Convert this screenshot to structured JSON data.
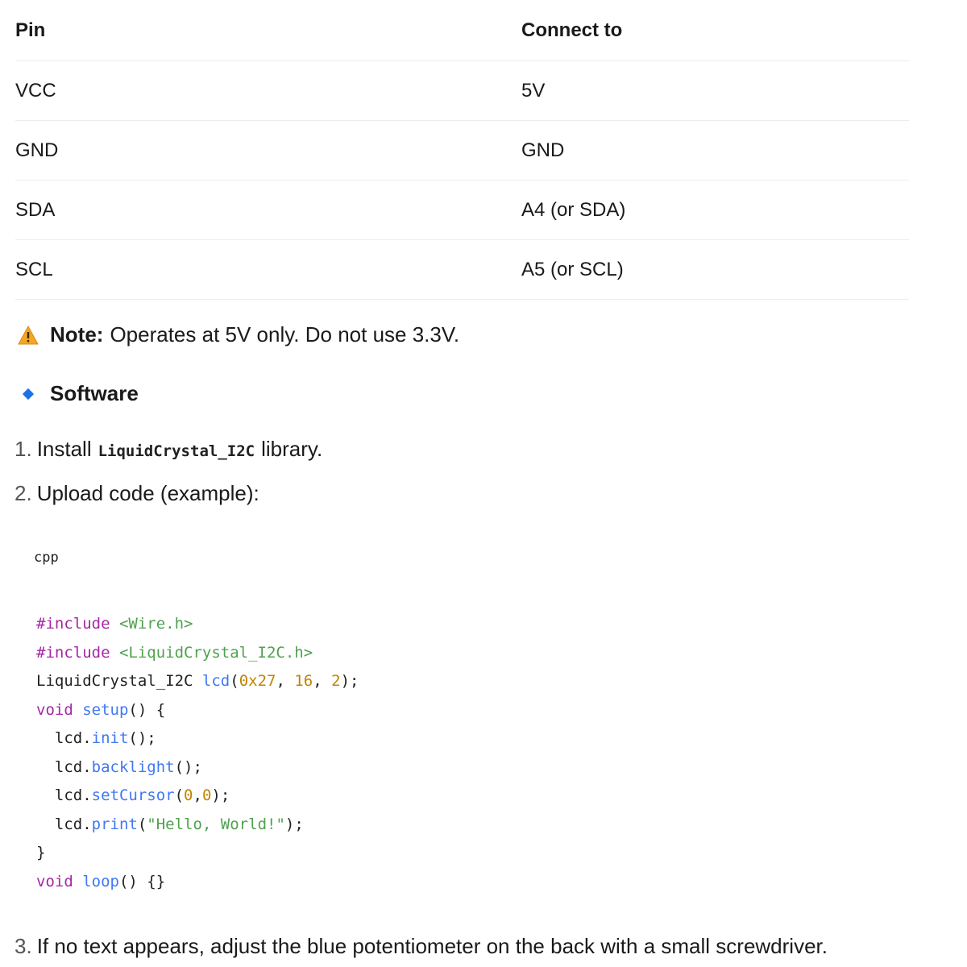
{
  "pin_table": {
    "headers": [
      "Pin",
      "Connect to"
    ],
    "rows": [
      [
        "VCC",
        "5V"
      ],
      [
        "GND",
        "GND"
      ],
      [
        "SDA",
        "A4 (or SDA)"
      ],
      [
        "SCL",
        "A5 (or SCL)"
      ]
    ]
  },
  "note": {
    "icon": "warning-icon",
    "label": "Note:",
    "text": "Operates at 5V only. Do not use 3.3V."
  },
  "section": {
    "icon": "diamond-icon",
    "title": "Software"
  },
  "steps": [
    {
      "num": "1.",
      "before": "Install",
      "code": "LiquidCrystal_I2C",
      "after": "library."
    },
    {
      "num": "2.",
      "text": "Upload code (example):"
    },
    {
      "num": "3.",
      "text": "If no text appears, adjust the blue potentiometer on the back with a small screwdriver."
    }
  ],
  "code": {
    "language": "cpp",
    "lines": [
      [
        {
          "t": "pre",
          "v": "#include "
        },
        {
          "t": "str",
          "v": "<Wire.h>"
        }
      ],
      [
        {
          "t": "pre",
          "v": "#include "
        },
        {
          "t": "str",
          "v": "<LiquidCrystal_I2C.h>"
        }
      ],
      [
        {
          "t": "plain",
          "v": "LiquidCrystal_I2C "
        },
        {
          "t": "fn",
          "v": "lcd"
        },
        {
          "t": "plain",
          "v": "("
        },
        {
          "t": "num",
          "v": "0x27"
        },
        {
          "t": "plain",
          "v": ", "
        },
        {
          "t": "num",
          "v": "16"
        },
        {
          "t": "plain",
          "v": ", "
        },
        {
          "t": "num",
          "v": "2"
        },
        {
          "t": "plain",
          "v": ");"
        }
      ],
      [
        {
          "t": "kw",
          "v": "void "
        },
        {
          "t": "fn",
          "v": "setup"
        },
        {
          "t": "plain",
          "v": "() {"
        }
      ],
      [
        {
          "t": "plain",
          "v": "  lcd."
        },
        {
          "t": "fn",
          "v": "init"
        },
        {
          "t": "plain",
          "v": "();"
        }
      ],
      [
        {
          "t": "plain",
          "v": "  lcd."
        },
        {
          "t": "fn",
          "v": "backlight"
        },
        {
          "t": "plain",
          "v": "();"
        }
      ],
      [
        {
          "t": "plain",
          "v": "  lcd."
        },
        {
          "t": "fn",
          "v": "setCursor"
        },
        {
          "t": "plain",
          "v": "("
        },
        {
          "t": "num",
          "v": "0"
        },
        {
          "t": "plain",
          "v": ","
        },
        {
          "t": "num",
          "v": "0"
        },
        {
          "t": "plain",
          "v": ");"
        }
      ],
      [
        {
          "t": "plain",
          "v": "  lcd."
        },
        {
          "t": "fn",
          "v": "print"
        },
        {
          "t": "plain",
          "v": "("
        },
        {
          "t": "str",
          "v": "\"Hello, World!\""
        },
        {
          "t": "plain",
          "v": ");"
        }
      ],
      [
        {
          "t": "plain",
          "v": "}"
        }
      ],
      [
        {
          "t": "kw",
          "v": "void "
        },
        {
          "t": "fn",
          "v": "loop"
        },
        {
          "t": "plain",
          "v": "() {}"
        }
      ]
    ]
  }
}
